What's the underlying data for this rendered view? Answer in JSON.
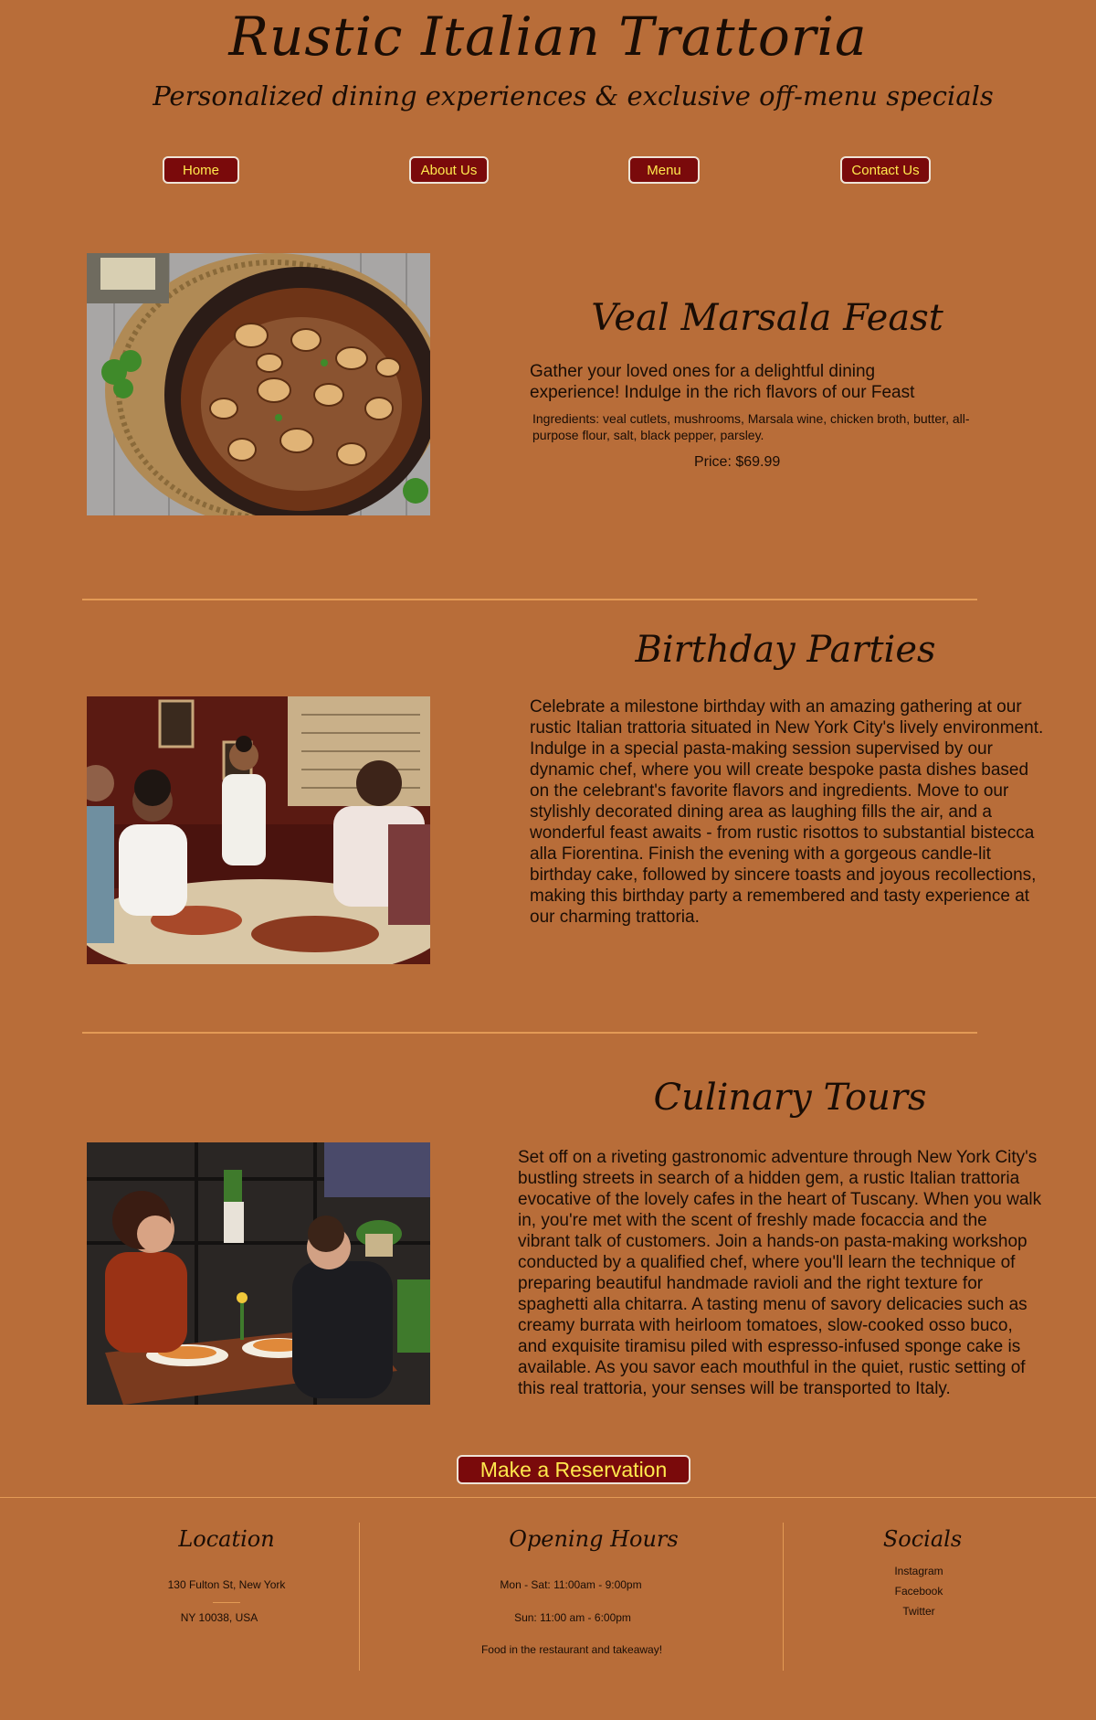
{
  "header": {
    "title": "Rustic Italian Trattoria",
    "subtitle": "Personalized dining experiences & exclusive off-menu specials"
  },
  "nav": {
    "home": "Home",
    "about": "About Us",
    "menu": "Menu",
    "contact": "Contact Us"
  },
  "sections": {
    "veal": {
      "title": "Veal Marsala Feast",
      "body": "Gather your loved ones for a delightful dining experience! Indulge in the rich flavors of our Feast",
      "ingredients": "Ingredients: veal cutlets, mushrooms, Marsala wine, chicken broth, butter, all-purpose flour, salt, black pepper, parsley.",
      "price": "Price: $69.99"
    },
    "birthday": {
      "title": "Birthday Parties",
      "body": "Celebrate a milestone birthday with an amazing gathering at our rustic Italian trattoria situated in New York City's lively environment. Indulge in a special pasta-making session supervised by our dynamic chef, where you will create bespoke pasta dishes based on the celebrant's favorite flavors and ingredients. Move to our stylishly decorated dining area as laughing fills the air, and a wonderful feast awaits - from rustic risottos to substantial bistecca alla Fiorentina. Finish the evening with a gorgeous candle-lit birthday cake, followed by sincere toasts and joyous recollections, making this birthday party a remembered and tasty experience at our charming trattoria."
    },
    "tours": {
      "title": "Culinary Tours",
      "body": "Set off on a riveting gastronomic adventure through New York City's bustling streets in search of a hidden gem, a rustic Italian trattoria evocative of the lovely cafes in the heart of Tuscany. When you walk in, you're met with the scent of freshly made focaccia and the vibrant talk of customers. Join a hands-on pasta-making workshop conducted by a qualified chef, where you'll learn the technique of preparing beautiful handmade ravioli and the right texture for spaghetti alla chitarra. A tasting menu of savory delicacies such as creamy burrata with heirloom tomatoes, slow-cooked osso buco, and exquisite tiramisu piled with espresso-infused sponge cake is available. As you savor each mouthful in the quiet, rustic setting of this real trattoria, your senses will be transported to Italy."
    }
  },
  "reservation": {
    "label": "Make a Reservation"
  },
  "footer": {
    "location": {
      "title": "Location",
      "line1": "130 Fulton St,   New York",
      "line2": "NY 10038, USA"
    },
    "hours": {
      "title": "Opening Hours",
      "line1": "Mon - Sat: 11:00am - 9:00pm",
      "line2": "Sun: 11:00 am - 6:00pm",
      "line3": "Food in the restaurant and takeaway!"
    },
    "socials": {
      "title": "Socials",
      "links": [
        "Instagram",
        "Facebook",
        "Twitter"
      ]
    }
  },
  "colors": {
    "background": "#b86d39",
    "button": "#7a0a0b",
    "button_text": "#ffe94d",
    "divider": "#e39a55"
  }
}
